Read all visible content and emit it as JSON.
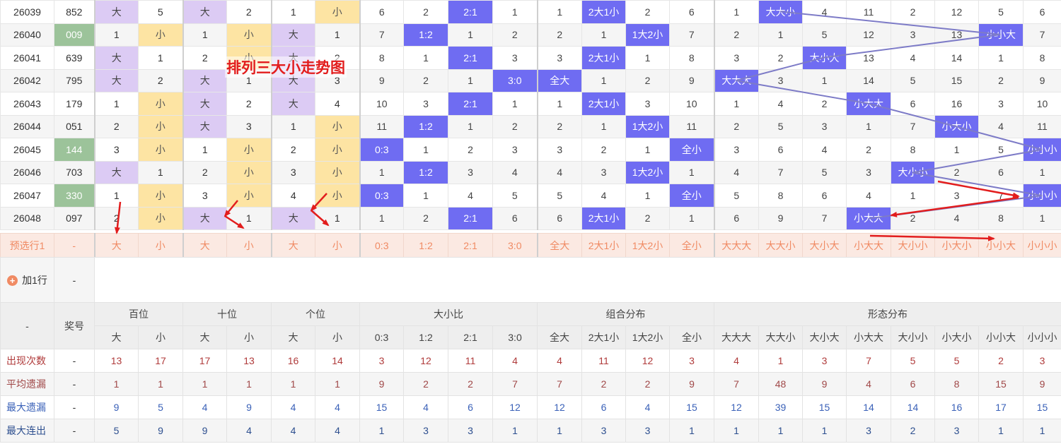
{
  "title": "排列三大小走势图",
  "draws": [
    {
      "issue": "26039",
      "prize": "852",
      "prize_highlight": false,
      "pos": [
        "大",
        "5",
        "大",
        "2",
        "1",
        "小"
      ],
      "ratio": [
        "6",
        "2",
        "2:1",
        "1"
      ],
      "combo": [
        "1",
        "2大1小",
        "2",
        "6"
      ],
      "form": [
        "1",
        "大大小",
        "4",
        "11",
        "2",
        "12",
        "5",
        "6"
      ]
    },
    {
      "issue": "26040",
      "prize": "009",
      "prize_highlight": true,
      "pos": [
        "1",
        "小",
        "1",
        "小",
        "大",
        "1"
      ],
      "ratio": [
        "7",
        "1:2",
        "1",
        "2"
      ],
      "combo": [
        "2",
        "1",
        "1大2小",
        "7"
      ],
      "form": [
        "2",
        "1",
        "5",
        "12",
        "3",
        "13",
        "小小大",
        "7"
      ]
    },
    {
      "issue": "26041",
      "prize": "639",
      "prize_highlight": false,
      "pos": [
        "大",
        "1",
        "2",
        "小",
        "大",
        "2"
      ],
      "ratio": [
        "8",
        "1",
        "2:1",
        "3"
      ],
      "combo": [
        "3",
        "2大1小",
        "1",
        "8"
      ],
      "form": [
        "3",
        "2",
        "大小大",
        "13",
        "4",
        "14",
        "1",
        "8"
      ]
    },
    {
      "issue": "26042",
      "prize": "795",
      "prize_highlight": false,
      "pos": [
        "大",
        "2",
        "大",
        "1",
        "大",
        "3"
      ],
      "ratio": [
        "9",
        "2",
        "1",
        "3:0"
      ],
      "combo": [
        "全大",
        "1",
        "2",
        "9"
      ],
      "form": [
        "大大大",
        "3",
        "1",
        "14",
        "5",
        "15",
        "2",
        "9"
      ]
    },
    {
      "issue": "26043",
      "prize": "179",
      "prize_highlight": false,
      "pos": [
        "1",
        "小",
        "大",
        "2",
        "大",
        "4"
      ],
      "ratio": [
        "10",
        "3",
        "2:1",
        "1"
      ],
      "combo": [
        "1",
        "2大1小",
        "3",
        "10"
      ],
      "form": [
        "1",
        "4",
        "2",
        "小大大",
        "6",
        "16",
        "3",
        "10"
      ]
    },
    {
      "issue": "26044",
      "prize": "051",
      "prize_highlight": false,
      "pos": [
        "2",
        "小",
        "大",
        "3",
        "1",
        "小"
      ],
      "ratio": [
        "11",
        "1:2",
        "1",
        "2"
      ],
      "combo": [
        "2",
        "1",
        "1大2小",
        "11"
      ],
      "form": [
        "2",
        "5",
        "3",
        "1",
        "7",
        "小大小",
        "4",
        "11"
      ]
    },
    {
      "issue": "26045",
      "prize": "144",
      "prize_highlight": true,
      "pos": [
        "3",
        "小",
        "1",
        "小",
        "2",
        "小"
      ],
      "ratio": [
        "0:3",
        "1",
        "2",
        "3"
      ],
      "combo": [
        "3",
        "2",
        "1",
        "全小"
      ],
      "form": [
        "3",
        "6",
        "4",
        "2",
        "8",
        "1",
        "5",
        "小小小"
      ]
    },
    {
      "issue": "26046",
      "prize": "703",
      "prize_highlight": false,
      "pos": [
        "大",
        "1",
        "2",
        "小",
        "3",
        "小"
      ],
      "ratio": [
        "1",
        "1:2",
        "3",
        "4"
      ],
      "combo": [
        "4",
        "3",
        "1大2小",
        "1"
      ],
      "form": [
        "4",
        "7",
        "5",
        "3",
        "大小小",
        "2",
        "6",
        "1"
      ]
    },
    {
      "issue": "26047",
      "prize": "330",
      "prize_highlight": true,
      "pos": [
        "1",
        "小",
        "3",
        "小",
        "4",
        "小"
      ],
      "ratio": [
        "0:3",
        "1",
        "4",
        "5"
      ],
      "combo": [
        "5",
        "4",
        "1",
        "全小"
      ],
      "form": [
        "5",
        "8",
        "6",
        "4",
        "1",
        "3",
        "7",
        "小小小"
      ]
    },
    {
      "issue": "26048",
      "prize": "097",
      "prize_highlight": false,
      "pos": [
        "2",
        "小",
        "大",
        "1",
        "大",
        "1"
      ],
      "ratio": [
        "1",
        "2",
        "2:1",
        "6"
      ],
      "combo": [
        "6",
        "2大1小",
        "2",
        "1"
      ],
      "form": [
        "6",
        "9",
        "7",
        "小大大",
        "2",
        "4",
        "8",
        "1"
      ]
    }
  ],
  "select_row": {
    "label": "预选行1",
    "prize": "-",
    "cells": [
      "大",
      "小",
      "大",
      "小",
      "大",
      "小",
      "0:3",
      "1:2",
      "2:1",
      "3:0",
      "全大",
      "2大1小",
      "1大2小",
      "全小",
      "大大大",
      "大大小",
      "大小大",
      "小大大",
      "大小小",
      "小大小",
      "小小大",
      "小小小"
    ]
  },
  "add_row": {
    "label": "加1行",
    "prize": "-"
  },
  "stats_header": {
    "corner": "-",
    "prize": "奖号",
    "groups": [
      "百位",
      "十位",
      "个位",
      "大小比",
      "组合分布",
      "形态分布"
    ],
    "sub": [
      "大",
      "小",
      "大",
      "小",
      "大",
      "小",
      "0:3",
      "1:2",
      "2:1",
      "3:0",
      "全大",
      "2大1小",
      "1大2小",
      "全小",
      "大大大",
      "大大小",
      "大小大",
      "小大大",
      "大小小",
      "小大小",
      "小小大",
      "小小小"
    ]
  },
  "stats": [
    {
      "label": "出现次数",
      "prize": "-",
      "values": [
        "13",
        "17",
        "17",
        "13",
        "16",
        "14",
        "3",
        "12",
        "11",
        "4",
        "4",
        "11",
        "12",
        "3",
        "4",
        "1",
        "3",
        "7",
        "5",
        "5",
        "2",
        "3"
      ]
    },
    {
      "label": "平均遗漏",
      "prize": "-",
      "values": [
        "1",
        "1",
        "1",
        "1",
        "1",
        "1",
        "9",
        "2",
        "2",
        "7",
        "7",
        "2",
        "2",
        "9",
        "7",
        "48",
        "9",
        "4",
        "6",
        "8",
        "15",
        "9"
      ]
    },
    {
      "label": "最大遗漏",
      "prize": "-",
      "values": [
        "9",
        "5",
        "4",
        "9",
        "4",
        "4",
        "15",
        "4",
        "6",
        "12",
        "12",
        "6",
        "4",
        "15",
        "12",
        "39",
        "15",
        "14",
        "14",
        "16",
        "17",
        "15"
      ]
    },
    {
      "label": "最大连出",
      "prize": "-",
      "values": [
        "5",
        "9",
        "9",
        "4",
        "4",
        "4",
        "1",
        "3",
        "3",
        "1",
        "1",
        "3",
        "3",
        "1",
        "1",
        "1",
        "1",
        "3",
        "2",
        "3",
        "1",
        "1"
      ]
    }
  ],
  "colors": {
    "hit": "#6f6cf2",
    "big": "#dccbf4",
    "small": "#fde4a3",
    "prize": "#9cc39a",
    "select_bg": "#fbe9e2",
    "select_text": "#f08a63",
    "annotation": "#e21d1d",
    "trend_line": "#7d7bc7"
  }
}
